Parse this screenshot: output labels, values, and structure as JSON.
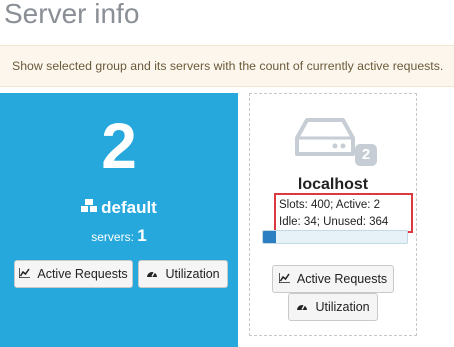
{
  "page": {
    "title": "Server info"
  },
  "info": {
    "text": "Show selected group and its servers with the count of currently active requests."
  },
  "group": {
    "active_count": "2",
    "name": "default",
    "servers_label": "servers:",
    "servers_count": "1",
    "icons": {
      "group": "cubes-icon",
      "chart": "line-chart-icon",
      "gauge": "dashboard-icon"
    },
    "active_requests_label": "Active Requests",
    "utilization_label": "Utilization",
    "background_color": "#27a8dd"
  },
  "server": {
    "icon": "hdd-icon",
    "badge": "2",
    "name": "localhost",
    "stats_line1": "Slots: 400; Active: 2",
    "stats_line2": "Idle: 34; Unused: 364",
    "progress_fraction": 0.09,
    "active_requests_label": "Active Requests",
    "utilization_label": "Utilization"
  }
}
